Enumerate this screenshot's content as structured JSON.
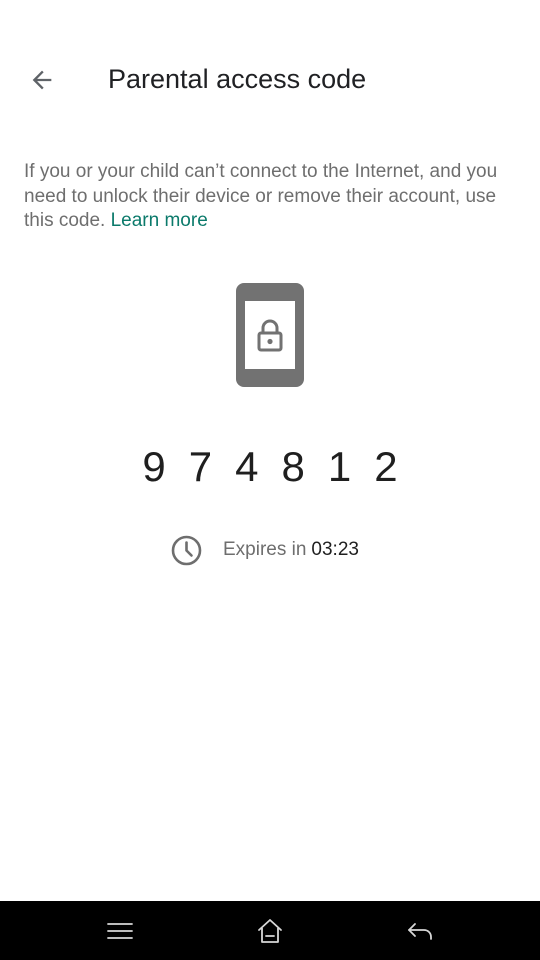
{
  "header": {
    "title": "Parental access code",
    "back_icon": "arrow-back-icon"
  },
  "description": {
    "text": "If you or your child can’t connect to the Internet, and you need to unlock their device or remove their account, use this code.",
    "link_text": "Learn more"
  },
  "illustration": {
    "icon": "locked-phone-icon"
  },
  "code": {
    "value": "974812"
  },
  "expiry": {
    "label": "Expires in",
    "time": "03:23",
    "icon": "clock-icon"
  },
  "nav_bar": {
    "menu_icon": "menu-icon",
    "home_icon": "home-icon",
    "back_icon": "back-icon"
  },
  "colors": {
    "accent": "#0b7a6b",
    "text_primary": "#202124",
    "text_secondary": "#6e6e6e",
    "illustration": "#727272",
    "nav_background": "#000000"
  }
}
